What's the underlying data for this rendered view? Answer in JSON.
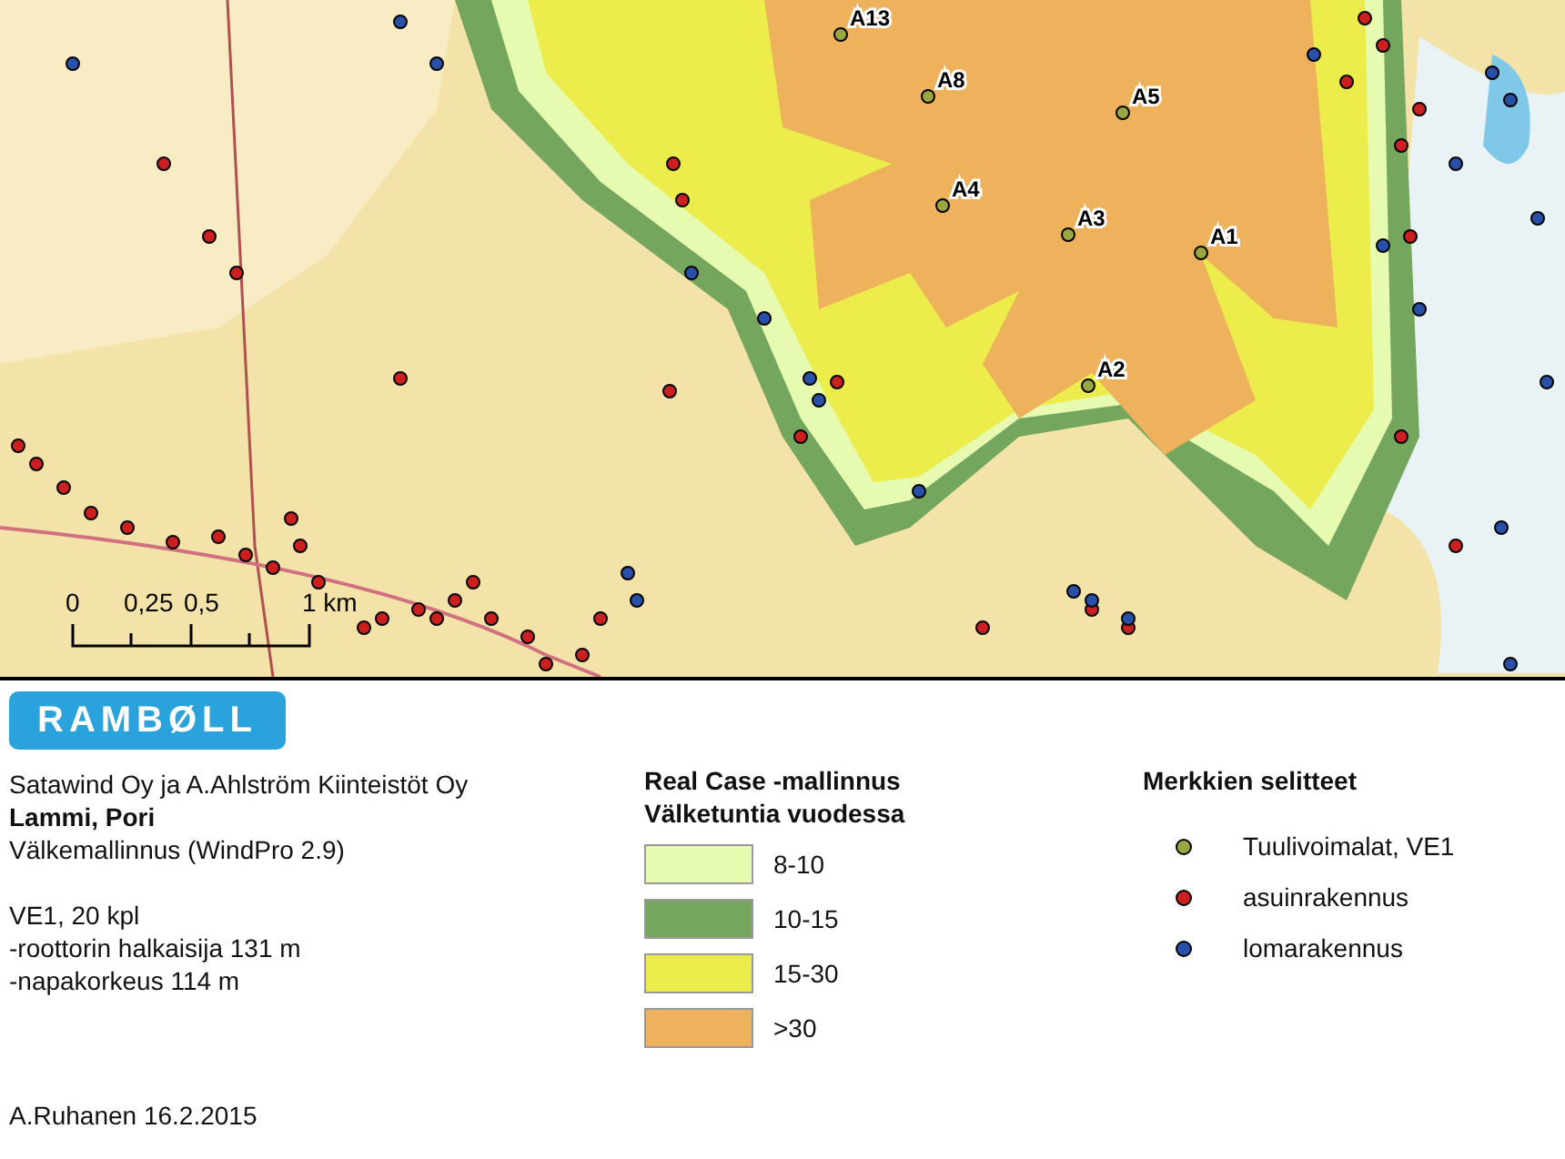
{
  "map": {
    "turbines": [
      {
        "label": "A13"
      },
      {
        "label": "A8"
      },
      {
        "label": "A5"
      },
      {
        "label": "A4"
      },
      {
        "label": "A3"
      },
      {
        "label": "A1"
      },
      {
        "label": "A2"
      }
    ],
    "scale_bar": [
      "0",
      "0,25",
      "0,5",
      "1 km"
    ]
  },
  "logo": "RAMBØLL",
  "project": {
    "client": "Satawind Oy ja A.Ahlström Kiinteistöt Oy",
    "site": "Lammi, Pori",
    "method": "Välkemallinnus (WindPro 2.9)",
    "variant": "VE1, 20 kpl",
    "specs": [
      "-roottorin halkaisija 131 m",
      "-napakorkeus 114 m"
    ],
    "author": "A.Ruhanen 16.2.2015"
  },
  "flicker_legend": {
    "title": "Real Case -mallinnus",
    "subtitle": "Välketuntia vuodessa",
    "items": [
      {
        "label": "8-10",
        "color": "#e6fbb0"
      },
      {
        "label": "10-15",
        "color": "#74a65e"
      },
      {
        "label": "15-30",
        "color": "#eced4c"
      },
      {
        "label": ">30",
        "color": "#eeb25c"
      }
    ]
  },
  "symbol_legend": {
    "title": "Merkkien selitteet",
    "items": [
      {
        "label": "Tuulivoimalat, VE1",
        "color": "#9aa640"
      },
      {
        "label": "asuinrakennus",
        "color": "#cc1f1f"
      },
      {
        "label": "lomarakennus",
        "color": "#2850a8"
      }
    ]
  }
}
